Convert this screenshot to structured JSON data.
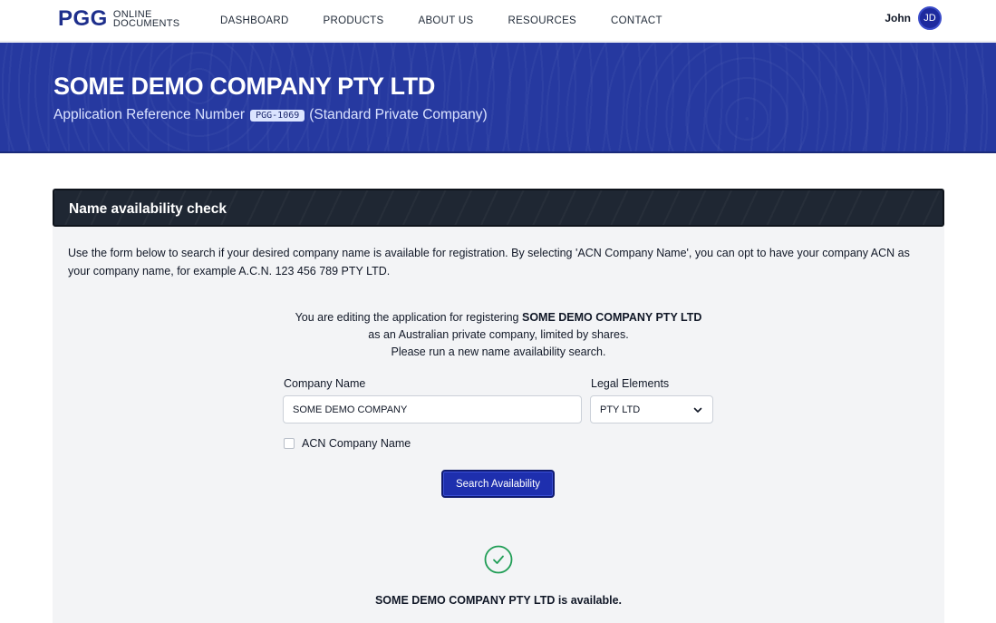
{
  "nav": {
    "logo_mark": "PGG",
    "logo_line1": "ONLINE",
    "logo_line2": "DOCUMENTS",
    "links": [
      "DASHBOARD",
      "PRODUCTS",
      "ABOUT US",
      "RESOURCES",
      "CONTACT"
    ],
    "user_name": "John",
    "user_initials": "JD"
  },
  "hero": {
    "company": "SOME DEMO COMPANY PTY LTD",
    "ref_label": "Application Reference Number",
    "ref_number": "PGG-1069",
    "company_type": "(Standard Private Company)"
  },
  "card": {
    "title": "Name availability check",
    "intro": "Use the form below to search if your desired company name is available for registration. By selecting 'ACN Company Name', you can opt to have your company ACN as your company name, for example A.C.N. 123 456 789 PTY LTD.",
    "editing_prefix": "You are editing the application for registering",
    "editing_company": "SOME DEMO COMPANY PTY LTD",
    "editing_line2": "as an Australian private company, limited by shares.",
    "editing_line3": "Please run a new name availability search.",
    "company_name_label": "Company Name",
    "company_name_value": "SOME DEMO COMPANY",
    "legal_elements_label": "Legal Elements",
    "legal_elements_value": "PTY LTD",
    "acn_label": "ACN Company Name",
    "acn_checked": false,
    "search_button": "Search Availability",
    "result_text": "SOME DEMO COMPANY PTY LTD is available."
  },
  "colors": {
    "brand": "#1e2f8c",
    "hero_bg": "#2639a0",
    "card_header": "#1f2733",
    "success": "#1f9d55"
  }
}
